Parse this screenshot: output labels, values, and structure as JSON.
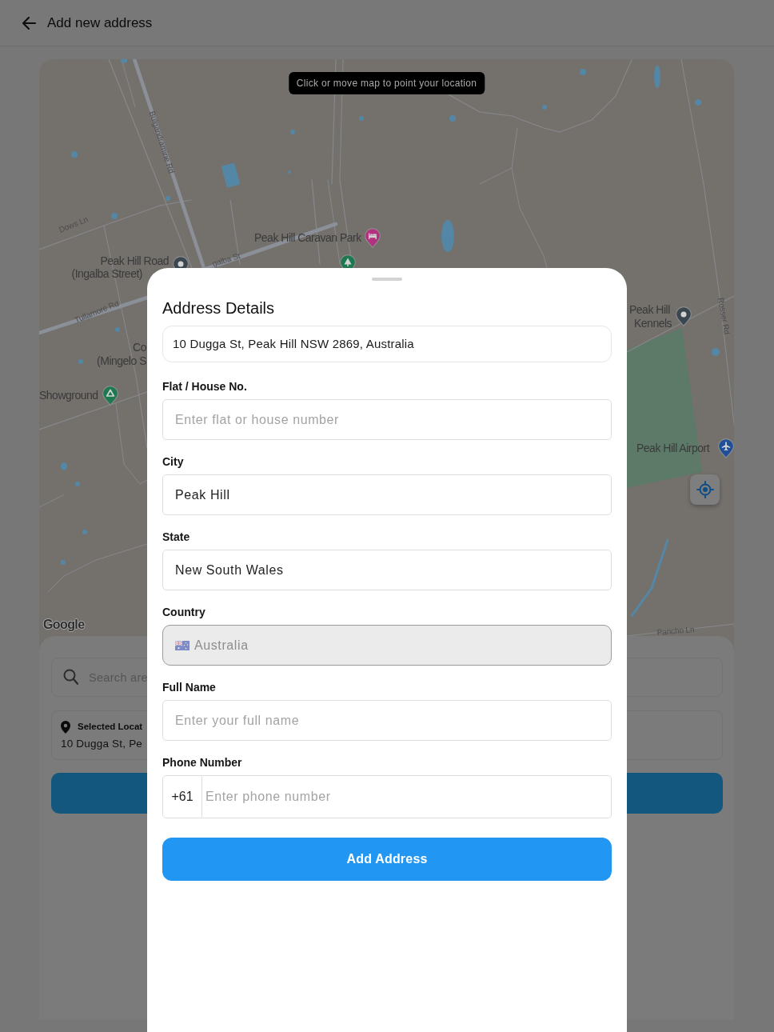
{
  "header": {
    "title": "Add new address"
  },
  "map": {
    "hint": "Click or move map to point your location",
    "logo": "Google",
    "labels": [
      {
        "kind": "road",
        "text": "Bulgandramine Rd"
      },
      {
        "kind": "road",
        "text": "Dows Ln"
      },
      {
        "kind": "place",
        "text": "Peak Hill Caravan Park"
      },
      {
        "kind": "place",
        "text": "Peak Hill Road"
      },
      {
        "kind": "road",
        "text": "galba St"
      },
      {
        "kind": "place",
        "text": "(Ingalba Street)"
      },
      {
        "kind": "place",
        "text": "Peak Hill"
      },
      {
        "kind": "road",
        "text": "Rosser Rd"
      },
      {
        "kind": "road",
        "text": "Tullamore Rd"
      },
      {
        "kind": "place",
        "text": "Kennels"
      },
      {
        "kind": "place",
        "text": "Co"
      },
      {
        "kind": "place",
        "text": "(Mingelo S"
      },
      {
        "kind": "place",
        "text": "Showground"
      },
      {
        "kind": "place",
        "text": "Peak Hill Airport"
      },
      {
        "kind": "road",
        "text": "Pancho Ln"
      }
    ],
    "pins": [
      {
        "kind": "hotel",
        "color": "#b3327f"
      },
      {
        "kind": "generic",
        "color": "#3b4750"
      },
      {
        "kind": "park",
        "color": "#1d7a50"
      },
      {
        "kind": "generic",
        "color": "#3b4750"
      },
      {
        "kind": "campsite",
        "color": "#1d7a50"
      },
      {
        "kind": "airport",
        "color": "#1f4f99"
      }
    ]
  },
  "location_panel": {
    "search_placeholder": "Search are",
    "selected_label": "Selected Locat",
    "selected_address": "10 Dugga St, Pe"
  },
  "sheet": {
    "title": "Address Details",
    "address": "10 Dugga St, Peak Hill NSW 2869, Australia",
    "fields": [
      {
        "kind": "text",
        "label": "Flat / House No.",
        "placeholder": "Enter flat or house number",
        "disabled": false
      },
      {
        "kind": "text",
        "label": "City",
        "value": "Peak Hill",
        "disabled": false
      },
      {
        "kind": "text",
        "label": "State",
        "value": "New South Wales",
        "disabled": false
      },
      {
        "kind": "country",
        "label": "Country",
        "value": "Australia",
        "disabled": true
      },
      {
        "kind": "text",
        "label": "Full Name",
        "placeholder": "Enter your full name",
        "disabled": false
      },
      {
        "kind": "phone",
        "label": "Phone Number",
        "prefix": "+61",
        "placeholder": "Enter phone number",
        "disabled": false
      }
    ],
    "submit": "Add Address"
  }
}
